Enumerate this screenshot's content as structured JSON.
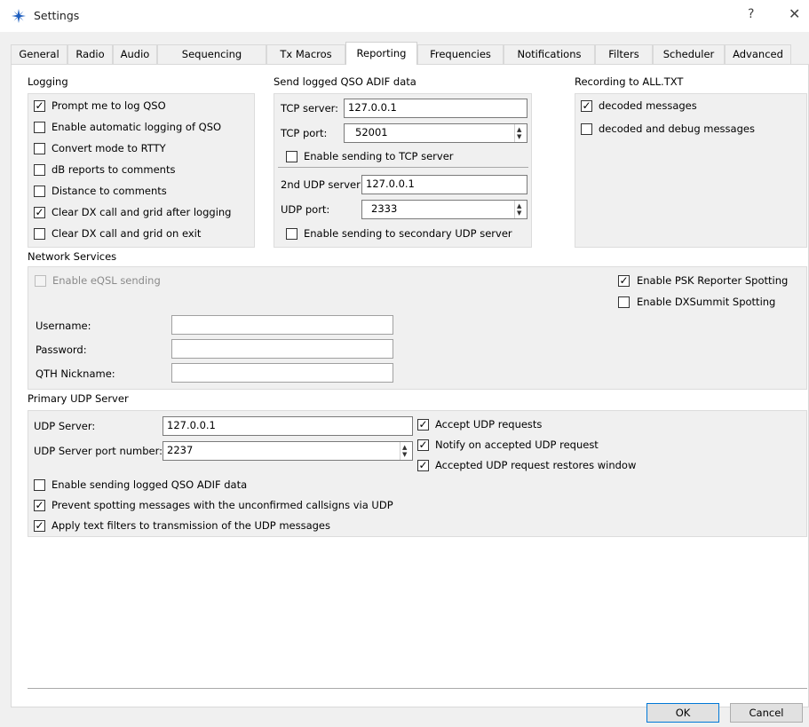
{
  "window": {
    "title": "Settings",
    "help": "?",
    "close": "✕"
  },
  "tabs": [
    {
      "label": "General"
    },
    {
      "label": "Radio"
    },
    {
      "label": "Audio"
    },
    {
      "label": "Sequencing"
    },
    {
      "label": "Tx Macros"
    },
    {
      "label": "Reporting"
    },
    {
      "label": "Frequencies"
    },
    {
      "label": "Notifications"
    },
    {
      "label": "Filters"
    },
    {
      "label": "Scheduler"
    },
    {
      "label": "Advanced"
    }
  ],
  "active_tab": "Reporting",
  "logging": {
    "title": "Logging",
    "items": [
      {
        "label": "Prompt me to log QSO",
        "checked": true,
        "mark": "✓"
      },
      {
        "label": "Enable automatic logging of QSO",
        "checked": false,
        "mark": ""
      },
      {
        "label": "Convert mode to RTTY",
        "checked": false,
        "mark": ""
      },
      {
        "label": "dB reports to comments",
        "checked": false,
        "mark": ""
      },
      {
        "label": "Distance to comments",
        "checked": false,
        "mark": ""
      },
      {
        "label": "Clear DX call and grid after logging",
        "checked": true,
        "mark": "✓"
      },
      {
        "label": "Clear DX call and grid on exit",
        "checked": false,
        "mark": ""
      }
    ]
  },
  "adif": {
    "title": "Send logged QSO ADIF data",
    "tcp_server_label": "TCP server:",
    "tcp_server_value": "127.0.0.1",
    "tcp_port_label": "TCP port:",
    "tcp_port_value": "52001",
    "enable_tcp": {
      "label": "Enable sending to TCP server",
      "checked": false,
      "mark": ""
    },
    "udp2_server_label": "2nd UDP server",
    "udp2_server_value": "127.0.0.1",
    "udp_port_label": "UDP port:",
    "udp_port_value": "2333",
    "enable_udp2": {
      "label": "Enable sending to secondary UDP server",
      "checked": false,
      "mark": ""
    }
  },
  "recording": {
    "title": "Recording to ALL.TXT",
    "decoded": {
      "label": "decoded messages",
      "checked": true,
      "mark": "✓"
    },
    "debug": {
      "label": "decoded and debug messages",
      "checked": false,
      "mark": ""
    }
  },
  "network": {
    "title": "Network Services",
    "eqsl": {
      "label": "Enable eQSL sending",
      "checked": false,
      "mark": "",
      "disabled": true
    },
    "psk": {
      "label": "Enable PSK Reporter Spotting",
      "checked": true,
      "mark": "✓"
    },
    "dxsummit": {
      "label": "Enable DXSummit Spotting",
      "checked": false,
      "mark": ""
    },
    "username_label": "Username:",
    "username_value": "",
    "password_label": "Password:",
    "password_value": "",
    "qth_label": "QTH Nickname:",
    "qth_value": ""
  },
  "primary_udp": {
    "title": "Primary UDP Server",
    "server_label": "UDP Server:",
    "server_value": "127.0.0.1",
    "port_label": "UDP Server port number:",
    "port_value": "2237",
    "accept": {
      "label": "Accept UDP requests",
      "checked": true,
      "mark": "✓"
    },
    "notify": {
      "label": "Notify on accepted UDP request",
      "checked": true,
      "mark": "✓"
    },
    "restore": {
      "label": "Accepted UDP request restores window",
      "checked": true,
      "mark": "✓"
    },
    "enable_adif": {
      "label": "Enable sending logged QSO ADIF data",
      "checked": false,
      "mark": ""
    },
    "prevent": {
      "label": "Prevent spotting messages with the unconfirmed callsigns via UDP",
      "checked": true,
      "mark": "✓"
    },
    "apply_filters": {
      "label": "Apply text filters to transmission of the UDP messages",
      "checked": true,
      "mark": "✓"
    }
  },
  "buttons": {
    "ok": "OK",
    "cancel": "Cancel"
  },
  "colors": {
    "accent": "#0078d7",
    "icon": "#1f5fbf"
  }
}
